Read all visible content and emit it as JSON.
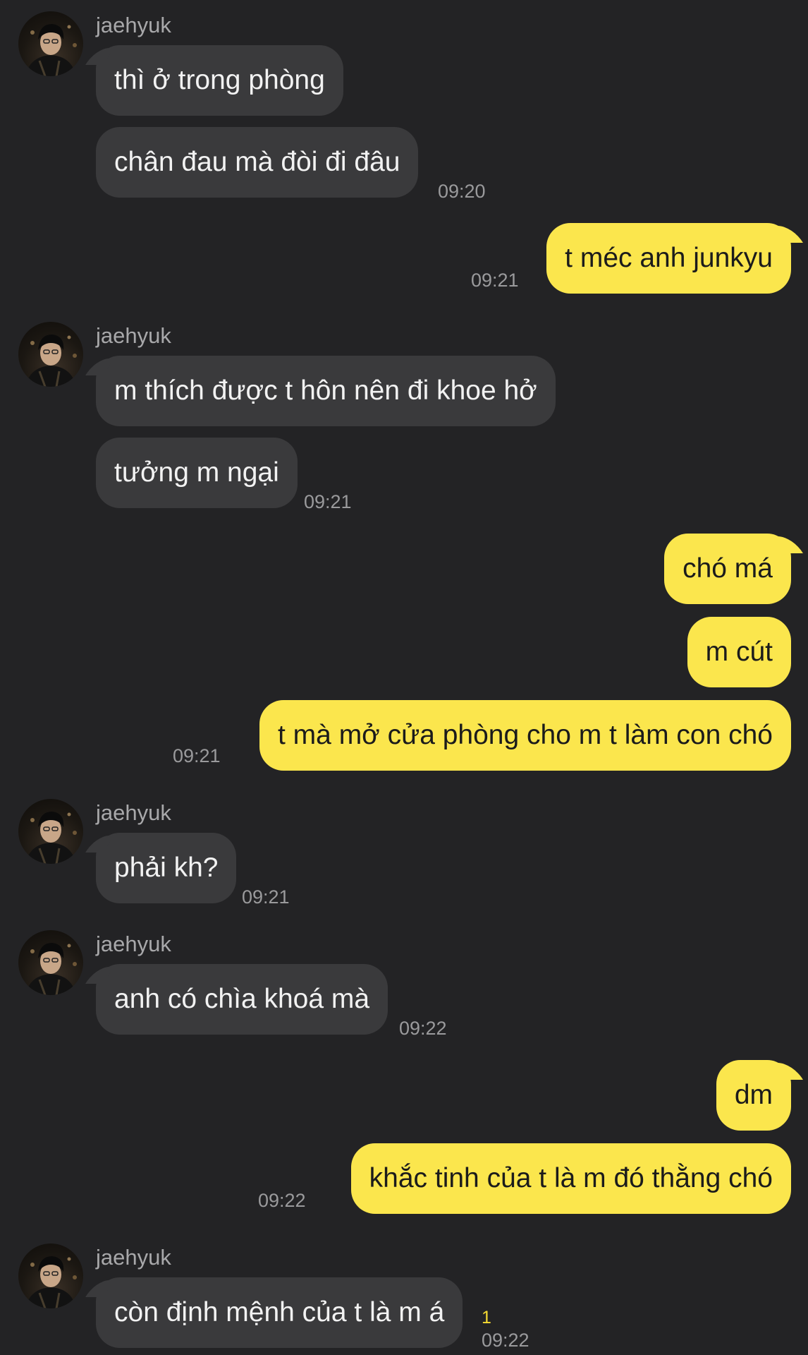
{
  "contact": {
    "name": "jaehyuk"
  },
  "messages": [
    {
      "side": "in",
      "text": "thì ở trong phòng"
    },
    {
      "side": "in",
      "text": "chân đau mà đòi đi đâu",
      "time": "09:20"
    },
    {
      "side": "out",
      "text": "t méc anh junkyu",
      "time": "09:21"
    },
    {
      "side": "in",
      "text": "m thích được t hôn nên đi khoe hở"
    },
    {
      "side": "in",
      "text": "tưởng m ngại",
      "time": "09:21"
    },
    {
      "side": "out",
      "text": "chó má"
    },
    {
      "side": "out",
      "text": "m cút"
    },
    {
      "side": "out",
      "text": "t mà mở cửa phòng cho m t làm con chó",
      "time": "09:21"
    },
    {
      "side": "in",
      "text": "phải kh?",
      "time": "09:21"
    },
    {
      "side": "in",
      "text": "anh có chìa khoá mà",
      "time": "09:22"
    },
    {
      "side": "out",
      "text": "dm"
    },
    {
      "side": "out",
      "text": "khắc tinh của t là m đó thằng chó",
      "time": "09:22"
    },
    {
      "side": "in",
      "text": "còn định mệnh của t là m á",
      "time": "09:22",
      "unread": "1"
    }
  ]
}
